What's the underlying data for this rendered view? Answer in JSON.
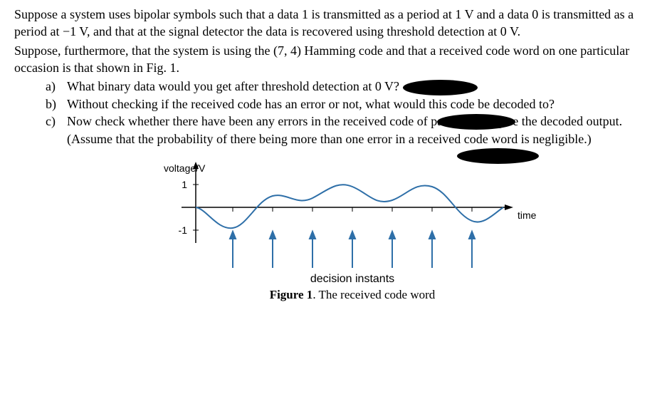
{
  "para1": "Suppose a system uses bipolar symbols such that a data 1 is transmitted as a period at 1 V and a data 0 is transmitted as a period at −1 V, and that at the signal detector the data is recovered using threshold detection at 0 V.",
  "para2": "Suppose, furthermore, that the system is using the (7, 4) Hamming code and that a received code word on one particular occasion is that shown in Fig. 1.",
  "items": {
    "a": {
      "marker": "a)",
      "text": "What binary data would you get after threshold detection at 0 V?"
    },
    "b": {
      "marker": "b)",
      "text": "Without checking if the received code has an error or not, what would this code be decoded to?"
    },
    "c": {
      "marker": "c)",
      "text": "Now check whether there have been any errors in the received code of part (a), and give the decoded output. (Assume that the probability of there being more than one error in a received code word is negligible.)"
    }
  },
  "figure": {
    "ylabel": "voltage/V",
    "xlabel": "time",
    "ytick_pos": "1",
    "ytick_neg": "-1",
    "arrows_label": "decision instants",
    "caption_bold": "Figure 1",
    "caption_rest": ". The received code word"
  },
  "chart_data": {
    "type": "line",
    "title": "The received code word",
    "xlabel": "time",
    "ylabel": "voltage/V",
    "ylim": [
      -1.3,
      1.3
    ],
    "decision_instants": [
      1,
      2,
      3,
      4,
      5,
      6,
      7
    ],
    "samples_at_instants": [
      -0.9,
      0.5,
      0.4,
      0.9,
      0.3,
      0.9,
      -0.6
    ],
    "threshold": 0,
    "detected_bits": [
      0,
      1,
      1,
      1,
      1,
      1,
      0
    ]
  }
}
